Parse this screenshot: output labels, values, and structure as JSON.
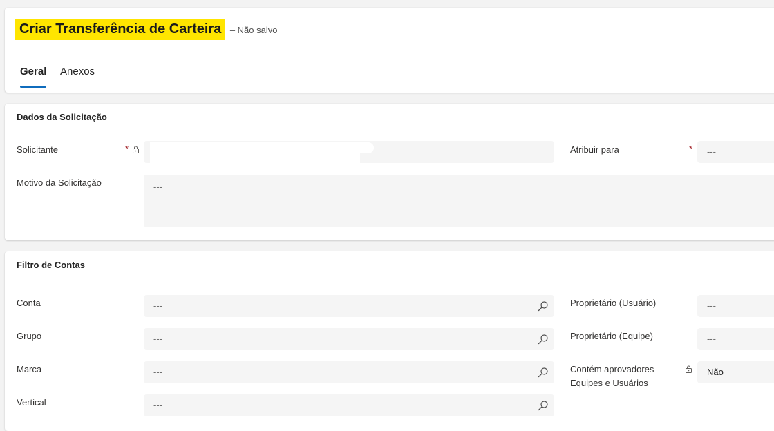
{
  "header": {
    "title": "Criar Transferência de Carteira",
    "status": "– Não salvo",
    "tabs": [
      {
        "label": "Geral",
        "active": true
      },
      {
        "label": "Anexos",
        "active": false
      }
    ]
  },
  "request_section": {
    "title": "Dados da Solicitação",
    "fields": {
      "solicitante": {
        "label": "Solicitante",
        "required_marker": "*",
        "value": ""
      },
      "atribuir_para": {
        "label": "Atribuir para",
        "required_marker": "*",
        "value": "---"
      },
      "motivo": {
        "label": "Motivo da Solicitação",
        "value": "---"
      }
    }
  },
  "filter_section": {
    "title": "Filtro de Contas",
    "fields": {
      "conta": {
        "label": "Conta",
        "value": "---"
      },
      "grupo": {
        "label": "Grupo",
        "value": "---"
      },
      "marca": {
        "label": "Marca",
        "value": "---"
      },
      "vertical": {
        "label": "Vertical",
        "value": "---"
      },
      "proprietario_usuario": {
        "label": "Proprietário (Usuário)",
        "value": "---"
      },
      "proprietario_equipe": {
        "label": "Proprietário (Equipe)",
        "value": "---"
      },
      "contem_aprovadores": {
        "label_line1": "Contém aprovadores",
        "label_line2": "Equipes e Usuários",
        "value": "Não"
      }
    }
  },
  "icons": {
    "lookup": "search-icon",
    "locked": "lock-icon"
  },
  "colors": {
    "title_highlight": "#ffe500",
    "tab_underline": "#0f6cbd",
    "required": "#a4262c",
    "field_bg": "#f5f5f5"
  }
}
